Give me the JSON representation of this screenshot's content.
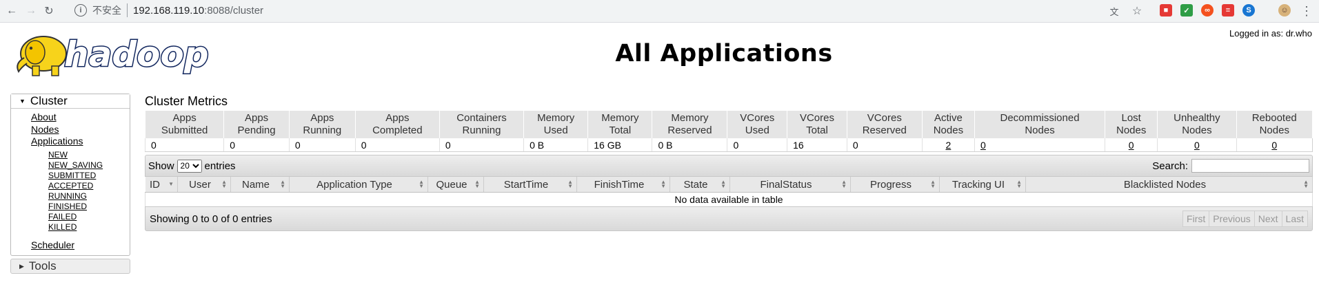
{
  "browser": {
    "insecure_label": "不安全",
    "url_host": "192.168.119.10",
    "url_rest": ":8088/cluster"
  },
  "header": {
    "logged_in": "Logged in as: dr.who",
    "title": "All Applications",
    "logo_text": "hadoop"
  },
  "sidebar": {
    "cluster_label": "Cluster",
    "items": [
      {
        "label": "About"
      },
      {
        "label": "Nodes"
      },
      {
        "label": "Applications"
      }
    ],
    "app_states": [
      "NEW",
      "NEW_SAVING",
      "SUBMITTED",
      "ACCEPTED",
      "RUNNING",
      "FINISHED",
      "FAILED",
      "KILLED"
    ],
    "scheduler_label": "Scheduler",
    "tools_label": "Tools"
  },
  "metrics": {
    "title": "Cluster Metrics",
    "headers": [
      [
        "Apps",
        "Submitted"
      ],
      [
        "Apps",
        "Pending"
      ],
      [
        "Apps",
        "Running"
      ],
      [
        "Apps",
        "Completed"
      ],
      [
        "Containers",
        "Running"
      ],
      [
        "Memory",
        "Used"
      ],
      [
        "Memory",
        "Total"
      ],
      [
        "Memory",
        "Reserved"
      ],
      [
        "VCores",
        "Used"
      ],
      [
        "VCores",
        "Total"
      ],
      [
        "VCores",
        "Reserved"
      ],
      [
        "Active",
        "Nodes"
      ],
      [
        "Decommissioned",
        "Nodes"
      ],
      [
        "Lost",
        "Nodes"
      ],
      [
        "Unhealthy",
        "Nodes"
      ],
      [
        "Rebooted",
        "Nodes"
      ]
    ],
    "values": [
      "0",
      "0",
      "0",
      "0",
      "0",
      "0 B",
      "16 GB",
      "0 B",
      "0",
      "16",
      "0",
      "2",
      "0",
      "0",
      "0",
      "0"
    ]
  },
  "apps_table": {
    "show_label": "Show",
    "entries_label": "entries",
    "page_size": "20",
    "search_label": "Search:",
    "columns": [
      "ID",
      "User",
      "Name",
      "Application Type",
      "Queue",
      "StartTime",
      "FinishTime",
      "State",
      "FinalStatus",
      "Progress",
      "Tracking UI",
      "Blacklisted Nodes"
    ],
    "empty_message": "No data available in table",
    "info": "Showing 0 to 0 of 0 entries",
    "pager": [
      "First",
      "Previous",
      "Next",
      "Last"
    ]
  }
}
